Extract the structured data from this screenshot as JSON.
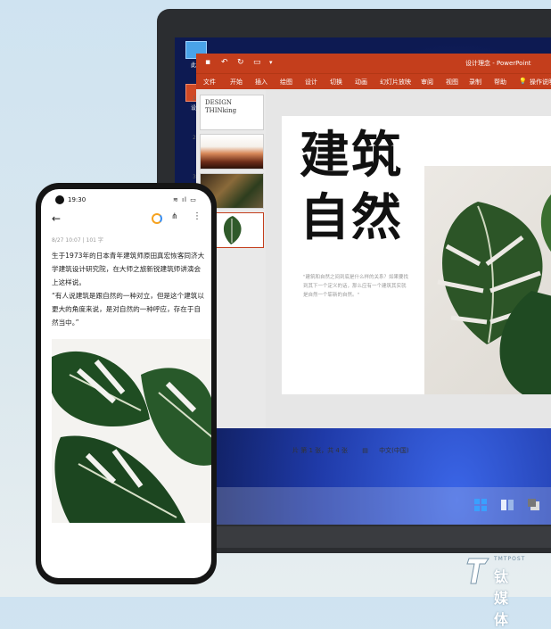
{
  "desktop": {
    "icons": [
      "此电",
      "设计"
    ]
  },
  "ppt": {
    "window_title": "设计理念 - PowerPoint",
    "menu": [
      "文件",
      "开始",
      "插入",
      "绘图",
      "设计",
      "切换",
      "动画",
      "幻灯片放映",
      "审阅",
      "视图",
      "录制",
      "帮助",
      "操作说明"
    ],
    "thumb1_text": "DESIGN THINking",
    "slide_title_line1": "建筑",
    "slide_title_line2": "自然",
    "slide_quote": "\"建筑和自然之间到底是什么样的关系？如果要找到其下一个定义的话，那么应有一个建筑其实就是自然一个崭新的自然。\"",
    "status_slide": "片 第 1 张，共 4 张",
    "status_lang": "中文(中国)"
  },
  "phone": {
    "time": "19:30",
    "meta": "8/27 10:07  |  101 字",
    "paragraph1": "生于1973年的日本青年建筑师原田真宏恢客同济大学建筑设计研究院，在大师之旅新锐建筑师讲演会上这样说。",
    "paragraph2": "“有人说建筑是跟自然的一种对立，但是这个建筑以更大的角度来说，是对自然的一种呼应，存在于自然当中。”"
  },
  "watermark": {
    "en": "TMTPOST",
    "cn": "钛媒体"
  }
}
